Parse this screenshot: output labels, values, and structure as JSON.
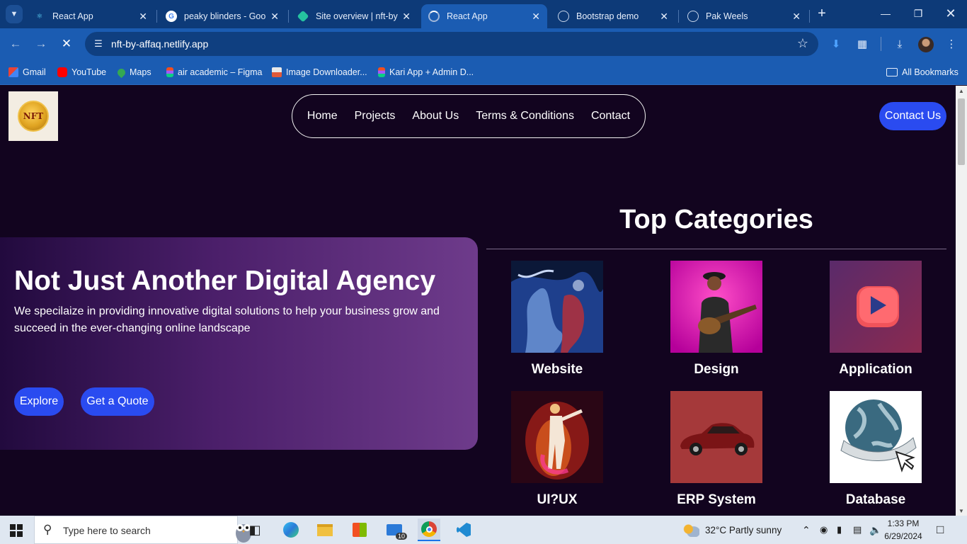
{
  "browser": {
    "tabs": [
      {
        "title": "React App",
        "icon": "react-icon",
        "active": false
      },
      {
        "title": "peaky blinders - Goo",
        "icon": "google-icon",
        "active": false
      },
      {
        "title": "Site overview | nft-by",
        "icon": "netlify-icon",
        "active": false
      },
      {
        "title": "React App",
        "icon": "loading-icon",
        "active": true
      },
      {
        "title": "Bootstrap demo",
        "icon": "globe-icon",
        "active": false
      },
      {
        "title": "Pak Weels",
        "icon": "globe-icon",
        "active": false
      }
    ],
    "address": "nft-by-affaq.netlify.app",
    "bookmarks": [
      {
        "label": "Gmail",
        "icon": "gmail-icon"
      },
      {
        "label": "YouTube",
        "icon": "youtube-icon"
      },
      {
        "label": "Maps",
        "icon": "maps-icon"
      },
      {
        "label": "air academic – Figma",
        "icon": "figma-icon"
      },
      {
        "label": "Image Downloader...",
        "icon": "image-icon"
      },
      {
        "label": "Kari App + Admin D...",
        "icon": "figma-icon"
      }
    ],
    "all_bookmarks": "All Bookmarks"
  },
  "site": {
    "logo_text": "NFT",
    "nav": [
      "Home",
      "Projects",
      "About Us",
      "Terms & Conditions",
      "Contact"
    ],
    "contact_button": "Contact Us",
    "hero": {
      "title": "Not Just Another Digital Agency",
      "subtitle": "We specilaize in providing innovative digital solutions to help your business grow and succeed in the ever-changing online landscape",
      "explore": "Explore",
      "quote": "Get a Quote"
    },
    "categories_title": "Top Categories",
    "categories": [
      {
        "label": "Website",
        "image": "abstract-blue-red-art"
      },
      {
        "label": "Design",
        "image": "guitarist-pink-background"
      },
      {
        "label": "Application",
        "image": "red-play-button-3d"
      },
      {
        "label": "UI?UX",
        "image": "dancing-couple-neon"
      },
      {
        "label": "ERP System",
        "image": "red-car"
      },
      {
        "label": "Database",
        "image": "globe-http-cursor"
      }
    ]
  },
  "taskbar": {
    "search_placeholder": "Type here to search",
    "mail_badge": "10",
    "weather": "32°C  Partly sunny",
    "time": "1:33 PM",
    "date": "6/29/2024"
  },
  "colors": {
    "browser_frame": "#1b5cb2",
    "page_bg": "#12041f",
    "accent_button": "#2a4bf0"
  }
}
